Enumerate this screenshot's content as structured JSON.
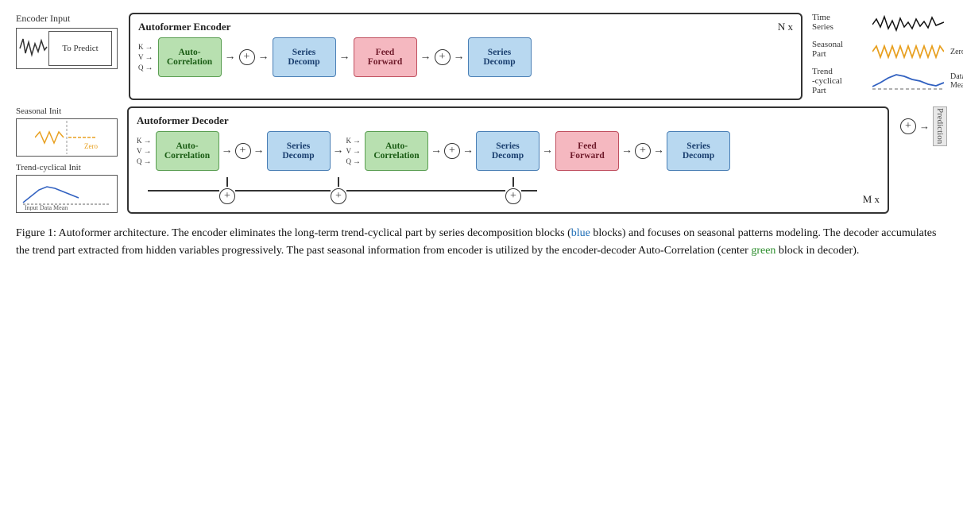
{
  "encoder": {
    "title": "Autoformer Encoder",
    "nx": "N x",
    "input_label": "Encoder Input",
    "to_predict": "To Predict",
    "blocks": [
      {
        "id": "auto-corr-enc",
        "label": "Auto-\nCorrelation",
        "type": "green"
      },
      {
        "id": "series-decomp-enc-1",
        "label": "Series\nDecomp",
        "type": "blue"
      },
      {
        "id": "feed-forward-enc",
        "label": "Feed\nForward",
        "type": "pink"
      },
      {
        "id": "series-decomp-enc-2",
        "label": "Series\nDecomp",
        "type": "blue"
      }
    ]
  },
  "decoder": {
    "title": "Autoformer Decoder",
    "mx": "M x",
    "seasonal_label": "Seasonal Init",
    "seasonal_sublabel": "Zero",
    "trend_label": "Trend-cyclical Init",
    "trend_sublabel": "Input Data Mean",
    "blocks": [
      {
        "id": "auto-corr-dec-1",
        "label": "Auto-\nCorrelation",
        "type": "green"
      },
      {
        "id": "series-decomp-dec-1",
        "label": "Series\nDecomp",
        "type": "blue"
      },
      {
        "id": "auto-corr-dec-2",
        "label": "Auto-\nCorrelation",
        "type": "green"
      },
      {
        "id": "series-decomp-dec-2",
        "label": "Series\nDecomp",
        "type": "blue"
      },
      {
        "id": "feed-forward-dec",
        "label": "Feed\nForward",
        "type": "pink"
      },
      {
        "id": "series-decomp-dec-3",
        "label": "Series\nDecomp",
        "type": "blue"
      }
    ],
    "prediction": "Prediction"
  },
  "legend": {
    "items": [
      {
        "label": "Time\nSeries",
        "color": "#111"
      },
      {
        "label": "Seasonal\nPart",
        "color": "#e8a020",
        "side": "Zero"
      },
      {
        "label": "Trend\n-cyclical\nPart",
        "color": "#3060c0",
        "side": "Data\nMean"
      }
    ]
  },
  "caption": {
    "full": "Figure 1: Autoformer architecture. The encoder eliminates the long-term trend-cyclical part by series decomposition blocks (blue blocks) and focuses on seasonal patterns modeling. The decoder accumulates the trend part extracted from hidden variables progressively. The past seasonal information from encoder is utilized by the encoder-decoder Auto-Correlation (center green block in decoder).",
    "blue_word": "blue",
    "green_word": "green"
  },
  "kvq": {
    "k": "K",
    "v": "V",
    "q": "Q"
  }
}
